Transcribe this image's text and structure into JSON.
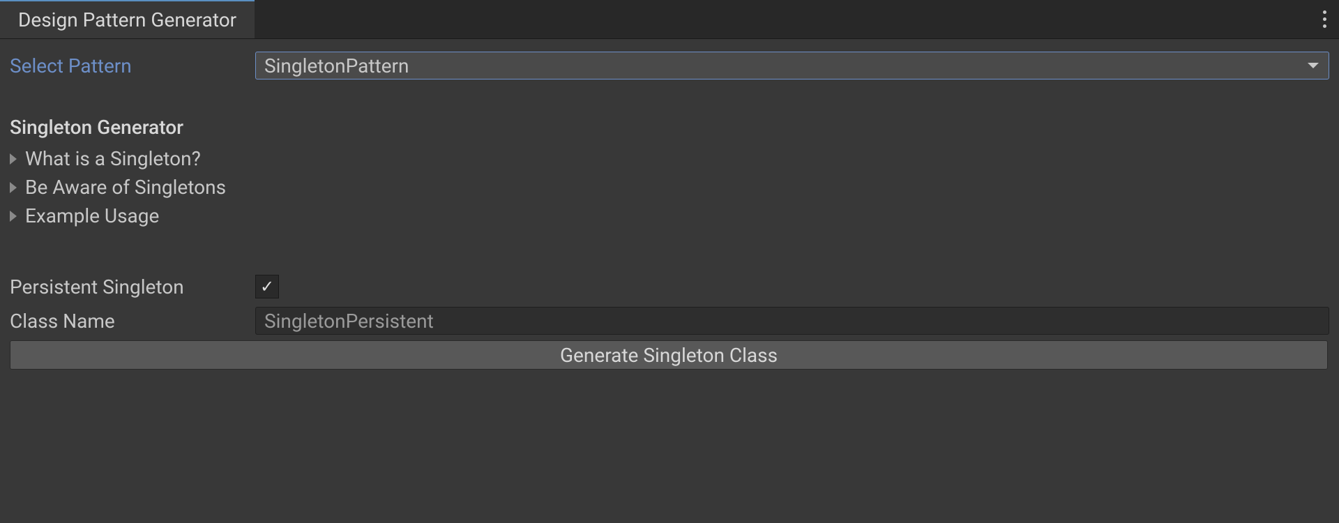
{
  "tab": {
    "title": "Design Pattern Generator"
  },
  "pattern_select": {
    "label": "Select Pattern",
    "value": "SingletonPattern"
  },
  "section": {
    "title": "Singleton Generator"
  },
  "foldouts": [
    {
      "label": "What is a Singleton?"
    },
    {
      "label": "Be Aware of Singletons"
    },
    {
      "label": "Example Usage"
    }
  ],
  "persistent": {
    "label": "Persistent Singleton",
    "checked": true
  },
  "class_name": {
    "label": "Class Name",
    "value": "SingletonPersistent"
  },
  "generate_button": {
    "label": "Generate Singleton Class"
  }
}
